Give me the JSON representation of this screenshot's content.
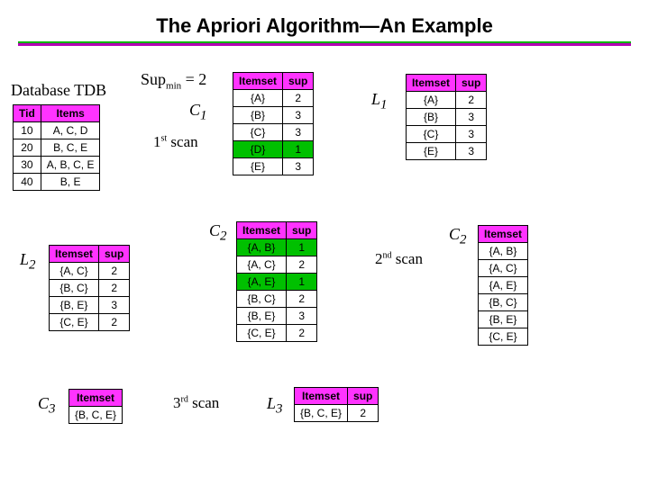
{
  "title": "The Apriori Algorithm—An Example",
  "db_label": "Database TDB",
  "supmin": "Sup",
  "supmin_sub": "min",
  "supmin_tail": " = 2",
  "tdb": {
    "headers": [
      "Tid",
      "Items"
    ],
    "rows": [
      [
        "10",
        "A, C, D"
      ],
      [
        "20",
        "B, C, E"
      ],
      [
        "30",
        "A, B, C, E"
      ],
      [
        "40",
        "B, E"
      ]
    ]
  },
  "C1": {
    "label": "C",
    "sub": "1",
    "headers": [
      "Itemset",
      "sup"
    ],
    "rows": [
      [
        "{A}",
        "2"
      ],
      [
        "{B}",
        "3"
      ],
      [
        "{C}",
        "3"
      ],
      [
        "{D}",
        "1"
      ],
      [
        "{E}",
        "3"
      ]
    ],
    "green_rows": [
      3
    ]
  },
  "L1": {
    "label": "L",
    "sub": "1",
    "headers": [
      "Itemset",
      "sup"
    ],
    "rows": [
      [
        "{A}",
        "2"
      ],
      [
        "{B}",
        "3"
      ],
      [
        "{C}",
        "3"
      ],
      [
        "{E}",
        "3"
      ]
    ]
  },
  "C2a": {
    "label": "C",
    "sub": "2",
    "headers": [
      "Itemset"
    ],
    "rows": [
      [
        "{A, B}"
      ],
      [
        "{A, C}"
      ],
      [
        "{A, E}"
      ],
      [
        "{B, C}"
      ],
      [
        "{B, E}"
      ],
      [
        "{C, E}"
      ]
    ]
  },
  "C2b": {
    "label": "C",
    "sub": "2",
    "headers": [
      "Itemset",
      "sup"
    ],
    "rows": [
      [
        "{A, B}",
        "1"
      ],
      [
        "{A, C}",
        "2"
      ],
      [
        "{A, E}",
        "1"
      ],
      [
        "{B, C}",
        "2"
      ],
      [
        "{B, E}",
        "3"
      ],
      [
        "{C, E}",
        "2"
      ]
    ],
    "green_rows": [
      0,
      2
    ]
  },
  "L2": {
    "label": "L",
    "sub": "2",
    "headers": [
      "Itemset",
      "sup"
    ],
    "rows": [
      [
        "{A, C}",
        "2"
      ],
      [
        "{B, C}",
        "2"
      ],
      [
        "{B, E}",
        "3"
      ],
      [
        "{C, E}",
        "2"
      ]
    ]
  },
  "C3": {
    "label": "C",
    "sub": "3",
    "headers": [
      "Itemset"
    ],
    "rows": [
      [
        "{B, C, E}"
      ]
    ]
  },
  "L3": {
    "label": "L",
    "sub": "3",
    "headers": [
      "Itemset",
      "sup"
    ],
    "rows": [
      [
        "{B, C, E}",
        "2"
      ]
    ]
  },
  "scan1": {
    "ord": "1",
    "sup": "st",
    "word": " scan"
  },
  "scan2": {
    "ord": "2",
    "sup": "nd",
    "word": " scan"
  },
  "scan3": {
    "ord": "3",
    "sup": "rd",
    "word": " scan"
  }
}
